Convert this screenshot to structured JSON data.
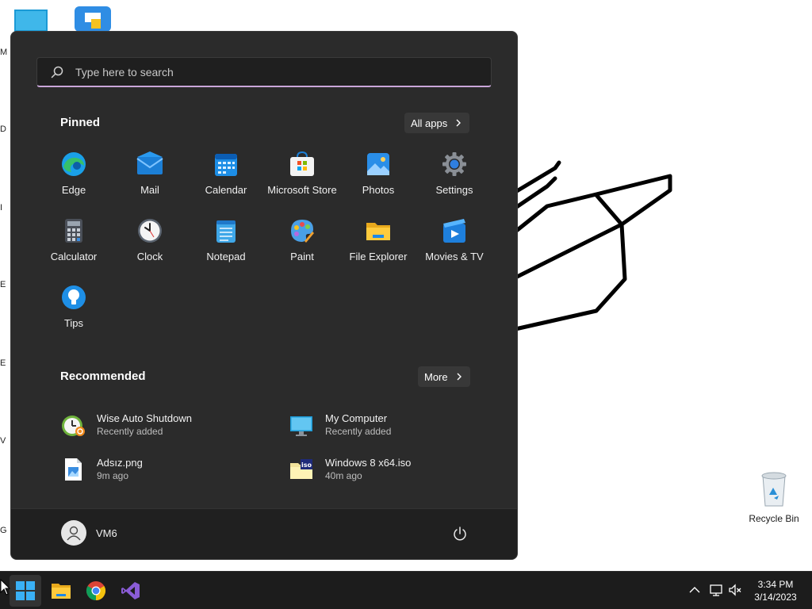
{
  "desktop": {
    "side_letters": [
      "M",
      "D",
      "I",
      "E",
      "E",
      "V",
      "G"
    ],
    "recycle_bin_label": "Recycle Bin"
  },
  "start_menu": {
    "search_placeholder": "Type here to search",
    "pinned_title": "Pinned",
    "all_apps_label": "All apps",
    "pinned": [
      {
        "label": "Edge",
        "icon": "edge-icon"
      },
      {
        "label": "Mail",
        "icon": "mail-icon"
      },
      {
        "label": "Calendar",
        "icon": "calendar-icon"
      },
      {
        "label": "Microsoft Store",
        "icon": "store-icon"
      },
      {
        "label": "Photos",
        "icon": "photos-icon"
      },
      {
        "label": "Settings",
        "icon": "gear-icon"
      },
      {
        "label": "Calculator",
        "icon": "calculator-icon"
      },
      {
        "label": "Clock",
        "icon": "clock-icon"
      },
      {
        "label": "Notepad",
        "icon": "notepad-icon"
      },
      {
        "label": "Paint",
        "icon": "paint-icon"
      },
      {
        "label": "File Explorer",
        "icon": "folder-icon"
      },
      {
        "label": "Movies & TV",
        "icon": "movies-icon"
      },
      {
        "label": "Tips",
        "icon": "lightbulb-icon"
      }
    ],
    "recommended_title": "Recommended",
    "more_label": "More",
    "recommended": [
      {
        "name": "Wise Auto Shutdown",
        "sub": "Recently added",
        "icon": "shutdown-clock-icon"
      },
      {
        "name": "My Computer",
        "sub": "Recently added",
        "icon": "monitor-icon"
      },
      {
        "name": "Adsız.png",
        "sub": "9m ago",
        "icon": "image-file-icon"
      },
      {
        "name": "Windows 8 x64.iso",
        "sub": "40m ago",
        "icon": "iso-file-icon"
      }
    ],
    "user_name": "VM6"
  },
  "taskbar": {
    "apps": [
      "windows-start-icon",
      "file-explorer-icon",
      "chrome-icon",
      "visual-studio-icon"
    ],
    "time": "3:34 PM",
    "date": "3/14/2023"
  },
  "colors": {
    "start_bg": "#2b2b2b",
    "footer_bg": "#202020",
    "taskbar_bg": "#1c1c1c",
    "accent": "#0078d4",
    "search_underline": "#c9a6d9"
  }
}
